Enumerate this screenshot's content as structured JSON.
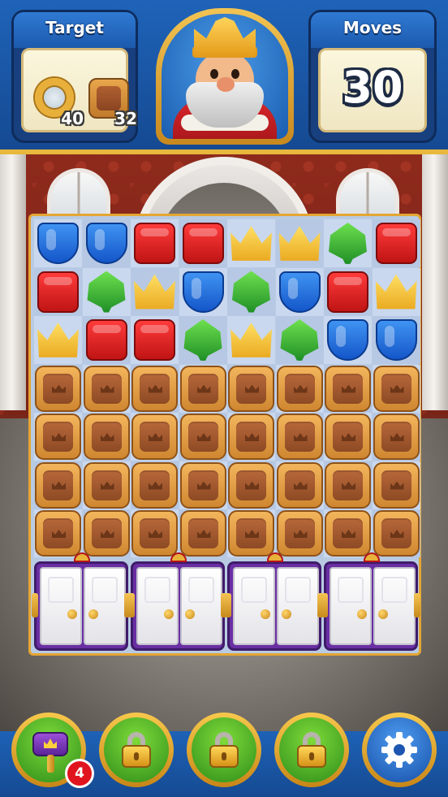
{
  "hud": {
    "target_label": "Target",
    "moves_label": "Moves",
    "moves_value": "30",
    "goals": [
      {
        "icon": "ring-icon",
        "count": "40"
      },
      {
        "icon": "crate-icon",
        "count": "32"
      }
    ]
  },
  "character": "king-portrait",
  "board": {
    "columns": 8,
    "rows": [
      [
        "shield",
        "shield",
        "box",
        "box",
        "crown",
        "crown",
        "leaf",
        "box"
      ],
      [
        "box",
        "leaf",
        "crown",
        "shield",
        "leaf",
        "shield",
        "box",
        "crown"
      ],
      [
        "crown",
        "box",
        "box",
        "leaf",
        "crown",
        "leaf",
        "shield",
        "shield"
      ],
      [
        "crate",
        "crate",
        "crate",
        "crate",
        "crate",
        "crate",
        "crate",
        "crate"
      ],
      [
        "crate",
        "crate",
        "crate",
        "crate",
        "crate",
        "crate",
        "crate",
        "crate"
      ],
      [
        "crate",
        "crate",
        "crate",
        "crate",
        "crate",
        "crate",
        "crate",
        "crate"
      ],
      [
        "crate",
        "crate",
        "crate",
        "crate",
        "crate",
        "crate",
        "crate",
        "crate"
      ]
    ],
    "cabinets": 4
  },
  "boosters": [
    {
      "name": "hammer-booster",
      "icon": "hammer-icon",
      "locked": false,
      "count": "4"
    },
    {
      "name": "locked-booster-1",
      "icon": "lock-icon",
      "locked": true
    },
    {
      "name": "locked-booster-2",
      "icon": "lock-icon",
      "locked": true
    },
    {
      "name": "locked-booster-3",
      "icon": "lock-icon",
      "locked": true
    },
    {
      "name": "settings-button",
      "icon": "gear-icon",
      "locked": false
    }
  ],
  "colors": {
    "hud_blue": "#1f63b8",
    "gold_trim": "#e7b83c",
    "shield": "#1456c9",
    "box": "#c01414",
    "crown": "#e9a51b",
    "leaf": "#1f8f26",
    "crate": "#cf8730"
  }
}
